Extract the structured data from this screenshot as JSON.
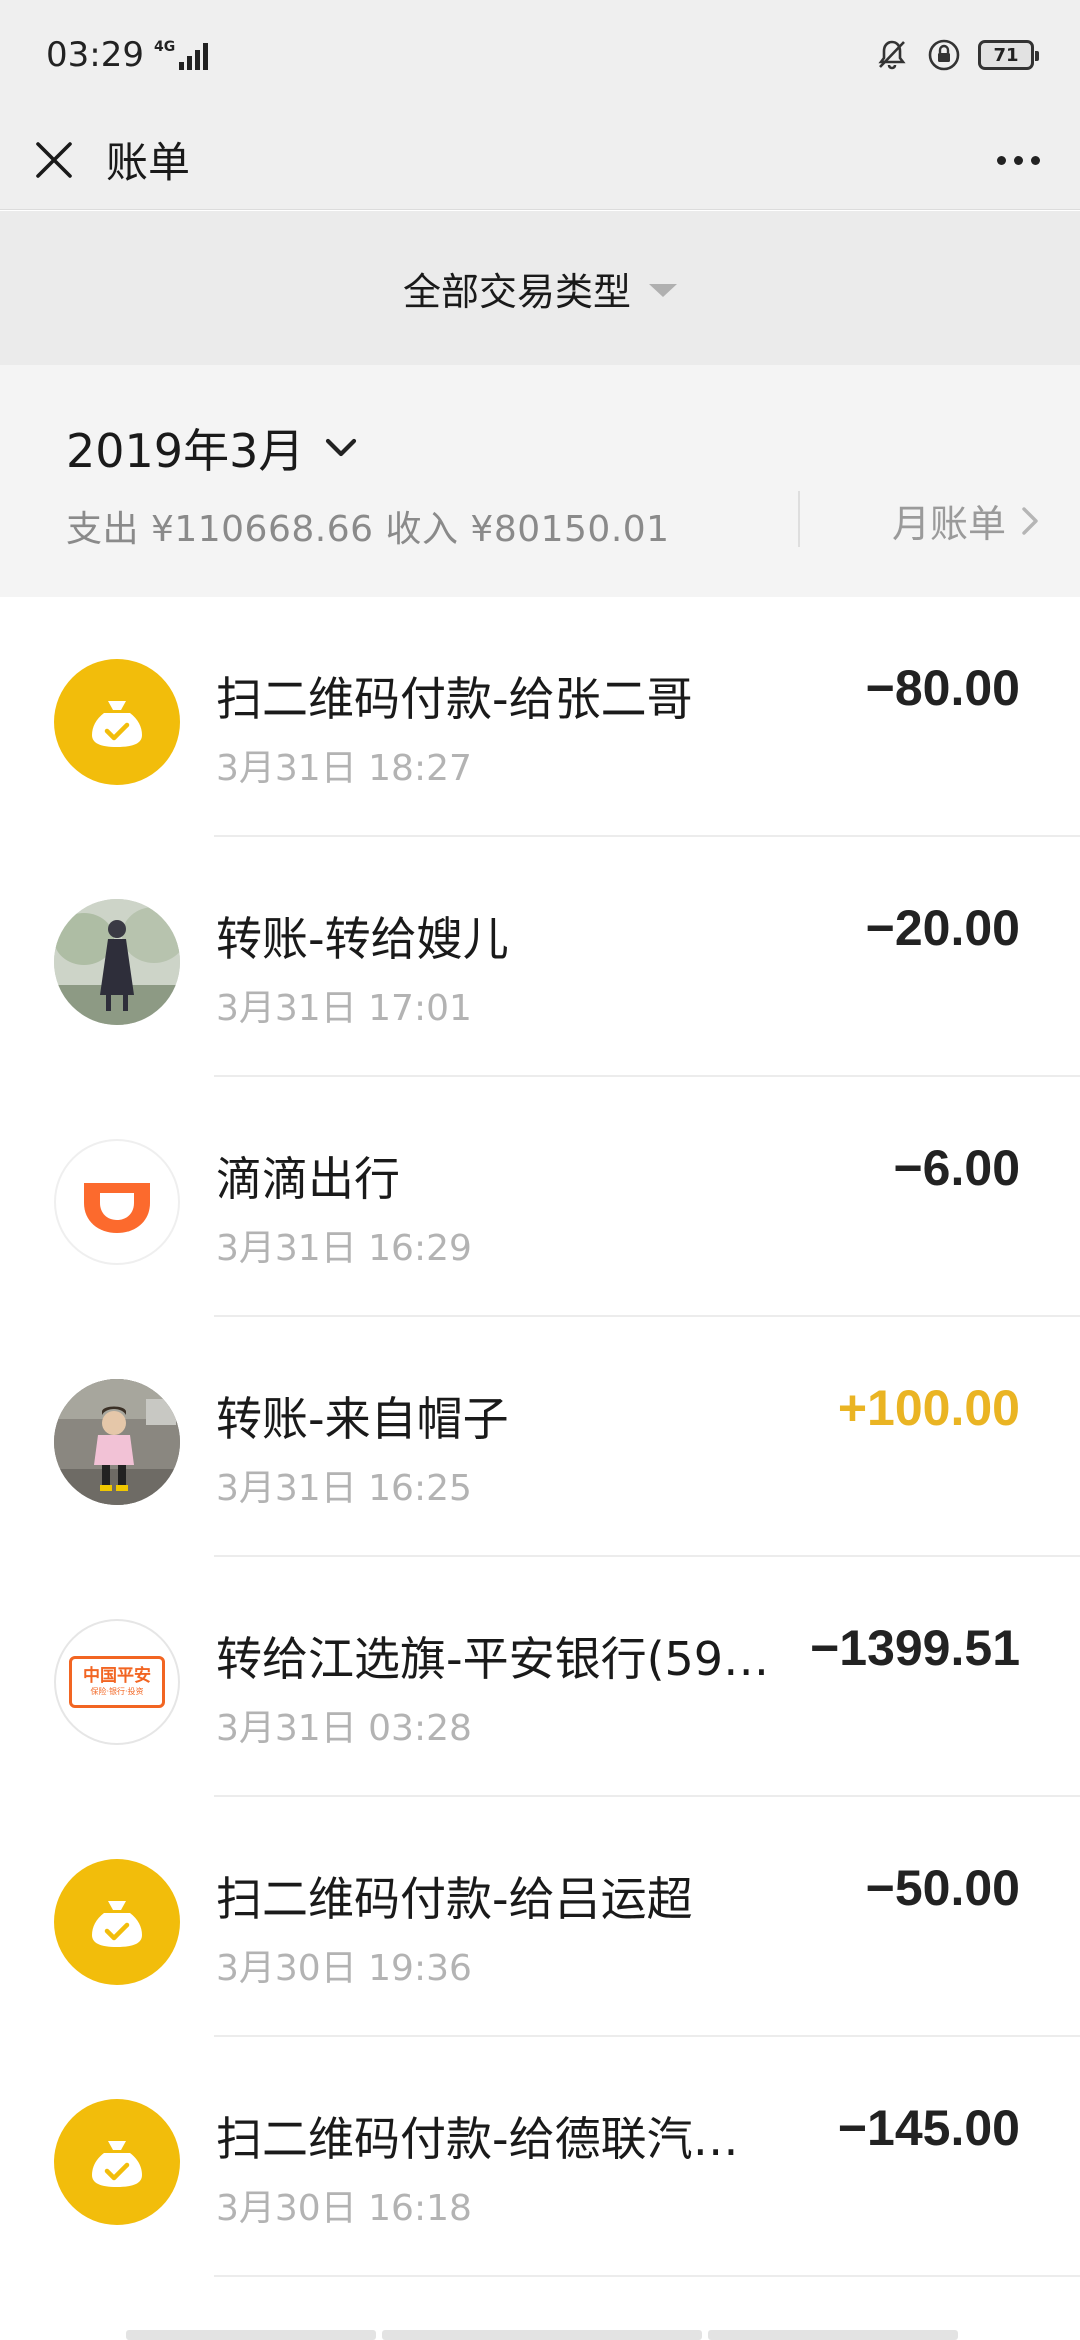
{
  "status": {
    "time": "03:29",
    "network": "4G",
    "battery": "71"
  },
  "header": {
    "title": "账单",
    "close_icon": "close-icon",
    "more_icon": "more-icon"
  },
  "filter": {
    "label": "全部交易类型"
  },
  "month": {
    "label": "2019年3月",
    "summary": "支出 ¥110668.66 收入 ¥80150.01",
    "bill_link": "月账单"
  },
  "colors": {
    "accent_income": "#eab423",
    "wallet_yellow": "#f2bd0b",
    "didi_orange": "#fc6a2d",
    "pingan_orange": "#f26522"
  },
  "transactions": [
    {
      "title": "扫二维码付款-给张二哥",
      "time": "3月31日 18:27",
      "amount": "−80.00",
      "icon": "wallet-icon"
    },
    {
      "title": "转账-转给嫂儿",
      "time": "3月31日 17:01",
      "amount": "−20.00",
      "icon": "user-avatar"
    },
    {
      "title": "滴滴出行",
      "time": "3月31日 16:29",
      "amount": "−6.00",
      "icon": "didi-logo"
    },
    {
      "title": "转账-来自帽子",
      "time": "3月31日 16:25",
      "amount": "+100.00",
      "icon": "user-avatar"
    },
    {
      "title": "转给江选旗-平安银行(59…",
      "time": "3月31日 03:28",
      "amount": "−1399.51",
      "icon": "pingan-bank-logo",
      "logo_text": "中国平安",
      "logo_sub": "保险·银行·投资"
    },
    {
      "title": "扫二维码付款-给吕运超",
      "time": "3月30日 19:36",
      "amount": "−50.00",
      "icon": "wallet-icon"
    },
    {
      "title": "扫二维码付款-给德联汽…",
      "time": "3月30日 16:18",
      "amount": "−145.00",
      "icon": "wallet-icon"
    }
  ]
}
